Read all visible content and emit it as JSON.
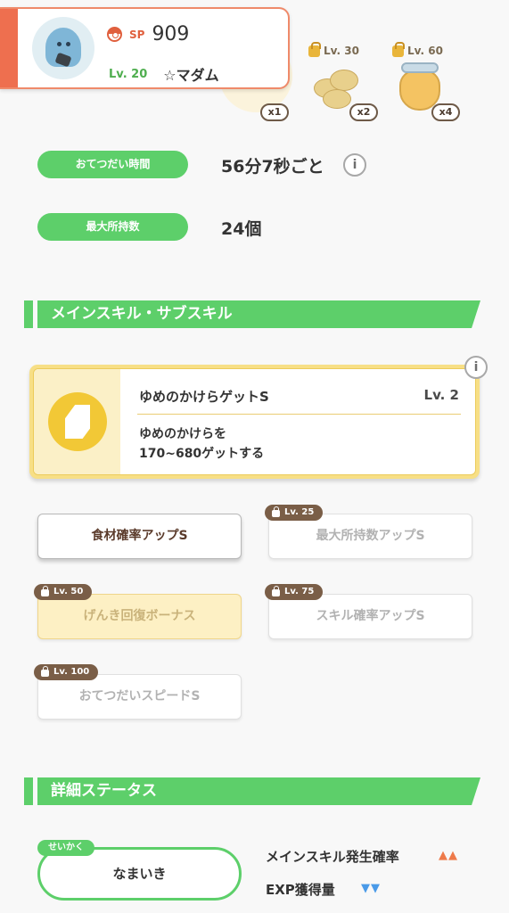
{
  "header": {
    "sp_label": "SP",
    "sp_value": "909",
    "level": "Lv. 20",
    "name": "☆マダム"
  },
  "ingredients": [
    {
      "quantity": "x1"
    },
    {
      "unlock": "Lv. 30",
      "quantity": "x2"
    },
    {
      "unlock": "Lv. 60",
      "quantity": "x4"
    }
  ],
  "stats": {
    "help_time_label": "おてつだい時間",
    "help_time_value": "56分7秒ごと",
    "help_time_info": "i",
    "max_carry_label": "最大所持数",
    "max_carry_value": "24個"
  },
  "sections": {
    "skills_title": "メインスキル・サブスキル",
    "details_title": "詳細ステータス"
  },
  "main_skill": {
    "name": "ゆめのかけらゲットS",
    "level": "Lv. 2",
    "description_line1": "ゆめのかけらを",
    "description_line2": "170~680ゲットする",
    "info": "i"
  },
  "sub_skills": [
    {
      "label": "食材確率アップS",
      "unlock": ""
    },
    {
      "label": "最大所持数アップS",
      "unlock": "Lv. 25"
    },
    {
      "label": "げんき回復ボーナス",
      "unlock": "Lv. 50"
    },
    {
      "label": "スキル確率アップS",
      "unlock": "Lv. 75"
    },
    {
      "label": "おてつだいスピードS",
      "unlock": "Lv. 100"
    }
  ],
  "nature": {
    "tag": "せいかく",
    "value": "なまいき",
    "effects": [
      {
        "label": "メインスキル発生確率",
        "arrows": "▲▲"
      },
      {
        "label": "EXP獲得量",
        "arrows": "▼▼"
      }
    ]
  },
  "colors": {
    "accent_green": "#5dcf6a",
    "accent_orange": "#ee6f4f",
    "skill_gold": "#f2c836",
    "up_arrow": "#ee7a4a",
    "down_arrow": "#4a9ae8"
  }
}
